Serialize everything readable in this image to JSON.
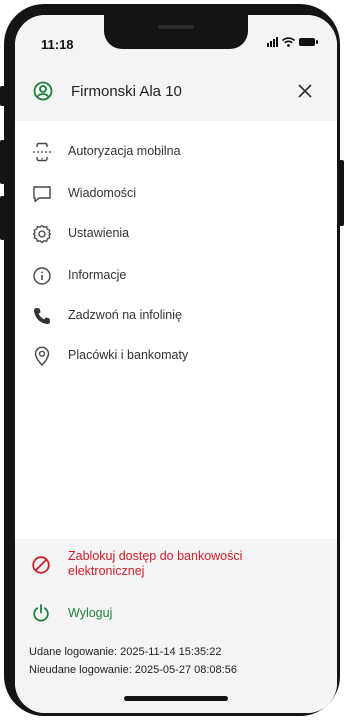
{
  "status_bar": {
    "time": "11:18"
  },
  "header": {
    "account_name": "Firmonski Ala 10"
  },
  "menu": {
    "items": [
      {
        "label": "Autoryzacja mobilna",
        "icon": "mobile-authorization-icon"
      },
      {
        "label": "Wiadomości",
        "icon": "message-icon"
      },
      {
        "label": "Ustawienia",
        "icon": "gear-icon"
      },
      {
        "label": "Informacje",
        "icon": "info-icon"
      },
      {
        "label": "Zadzwoń na infolinię",
        "icon": "phone-icon"
      },
      {
        "label": "Placówki i bankomaty",
        "icon": "location-pin-icon"
      }
    ]
  },
  "actions": {
    "block_label": "Zablokuj dostęp do bankowości elektronicznej",
    "logout_label": "Wyloguj"
  },
  "login_info": {
    "success": "Udane logowanie: 2025-11-14 15:35:22",
    "failed": "Nieudane logowanie: 2025-05-27 08:08:56"
  },
  "colors": {
    "accent_green": "#1e7f3a",
    "danger_red": "#cc1f2a"
  }
}
